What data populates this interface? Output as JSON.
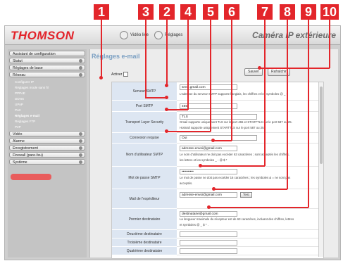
{
  "callouts": [
    "1",
    "2",
    "3",
    "4",
    "5",
    "6",
    "7",
    "8",
    "9",
    "10"
  ],
  "header": {
    "brand": "THOMSON",
    "tab_video": "Vidéo live",
    "tab_settings": "Réglages",
    "camera_title": "Caméra IP extérieure"
  },
  "sidebar": {
    "items": [
      "Assistant de configuration",
      "Statut",
      "Réglages de base",
      "Réseau",
      "Vidéo",
      "Alarme",
      "Enregistrement",
      "Firewall (pare-feu)",
      "Système"
    ],
    "sub_items": [
      "Configurer IP",
      "Réglages mode sans fil",
      "PPPoE",
      "DDNS",
      "UPnP",
      "Port",
      "Réglages e-mail",
      "Réglages FTP",
      "P2P"
    ]
  },
  "main": {
    "title": "Réglages e-mail",
    "enable_label": "Activer",
    "save_label": "Sauver",
    "refresh_label": "Rafraîchir"
  },
  "form": {
    "smtp_server_label": "Serveur SMTP",
    "smtp_server_value": "smtp.gmail.com",
    "smtp_server_hint": "L'adresse du serveur SMTP supporte l'anglais, les chiffres et les symboles @ _ -",
    "smtp_port_label": "Port SMTP",
    "smtp_port_value": "465",
    "tls_label": "Transport Layer Security",
    "tls_value": "TLS",
    "tls_hint1": "Gmail supporte uniquement TLS sur le port 465 et STARTTLS sur le port 587 ou 25.",
    "tls_hint2": "Hotmail supporte uniquement STARTTLS sur le port 587 ou 25.",
    "auth_label": "Connexion requise",
    "auth_value": "Oui",
    "user_label": "Nom d'utilisateur SMTP",
    "user_value": "adresse-envoi@gmail.com",
    "user_hint1": "Le nom d'utilisateur ne doit pas excéder 63 caractères ; sont acceptés les chiffres,",
    "user_hint2": "les lettres et les symboles _ - @ $ *",
    "pass_label": "Mot de passe SMTP",
    "pass_value": "••••••••••",
    "pass_hint1": "Le mot de passe ne doit pas excéder 16 caractères ; les symboles & = ne sont pas",
    "pass_hint2": "acceptés.",
    "sender_label": "Mail de l'expéditeur",
    "sender_value": "adresse-envoi@gmail.com",
    "test_label": "Test",
    "first_label": "Premier destinataire",
    "first_value": "destinataire@gmail.com",
    "first_hint1": "La longueur maximale du récepteur est de 63 caractères, incluant des chiffres, lettres",
    "first_hint2": "et symboles @ _ $ * .",
    "second_label": "Deuxième destinataire",
    "third_label": "Troisième destinataire",
    "fourth_label": "Quatrième destinataire"
  }
}
